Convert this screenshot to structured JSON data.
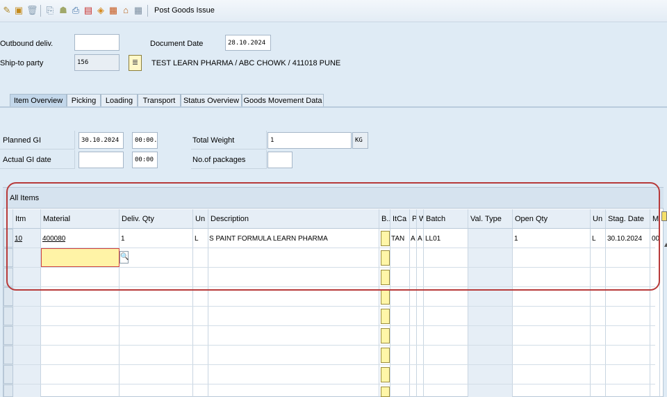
{
  "toolbar": {
    "icons": [
      "display-change-icon",
      "other-object-icon",
      "delete-icon",
      "outbound-icon",
      "header-icon",
      "print-icon",
      "output-icon",
      "pick-icon",
      "serial-icon",
      "home-icon",
      "batch-icon"
    ],
    "post_goods_issue": "Post Goods Issue"
  },
  "header": {
    "outbound_deliv_label": "Outbound deliv.",
    "outbound_deliv_value": "",
    "document_date_label": "Document Date",
    "document_date_value": "28.10.2024",
    "ship_to_label": "Ship-to party",
    "ship_to_value": "156",
    "ship_to_name": "TEST LEARN PHARMA / ABC CHOWK / 411018 PUNE"
  },
  "tabs": [
    "Item Overview",
    "Picking",
    "Loading",
    "Transport",
    "Status Overview",
    "Goods Movement Data"
  ],
  "item_overview": {
    "planned_gi_label": "Planned GI",
    "planned_gi_date": "30.10.2024",
    "planned_gi_time": "00:00..",
    "actual_gi_label": "Actual GI date",
    "actual_gi_date": "",
    "actual_gi_time": "00:00",
    "total_weight_label": "Total Weight",
    "total_weight_value": "1",
    "total_weight_unit": "KG",
    "packages_label": "No.of packages",
    "packages_value": ""
  },
  "table": {
    "title": "All Items",
    "columns": [
      "Itm",
      "Material",
      "Deliv. Qty",
      "Un",
      "Description",
      "B..",
      "ItCa",
      "P",
      "W",
      "Batch",
      "Val. Type",
      "Open Qty",
      "Un",
      "Stag. Date",
      "Ma"
    ],
    "rows": [
      {
        "itm": "10",
        "material": "400080",
        "deliv_qty": "1",
        "un": "L",
        "description": "S PAINT FORMULA LEARN PHARMA",
        "itca": "TAN",
        "p": "A",
        "w": "A",
        "batch": "LL01",
        "val_type": "",
        "open_qty": "1",
        "un2": "L",
        "stag_date": "30.10.2024",
        "ma": "00"
      }
    ]
  }
}
